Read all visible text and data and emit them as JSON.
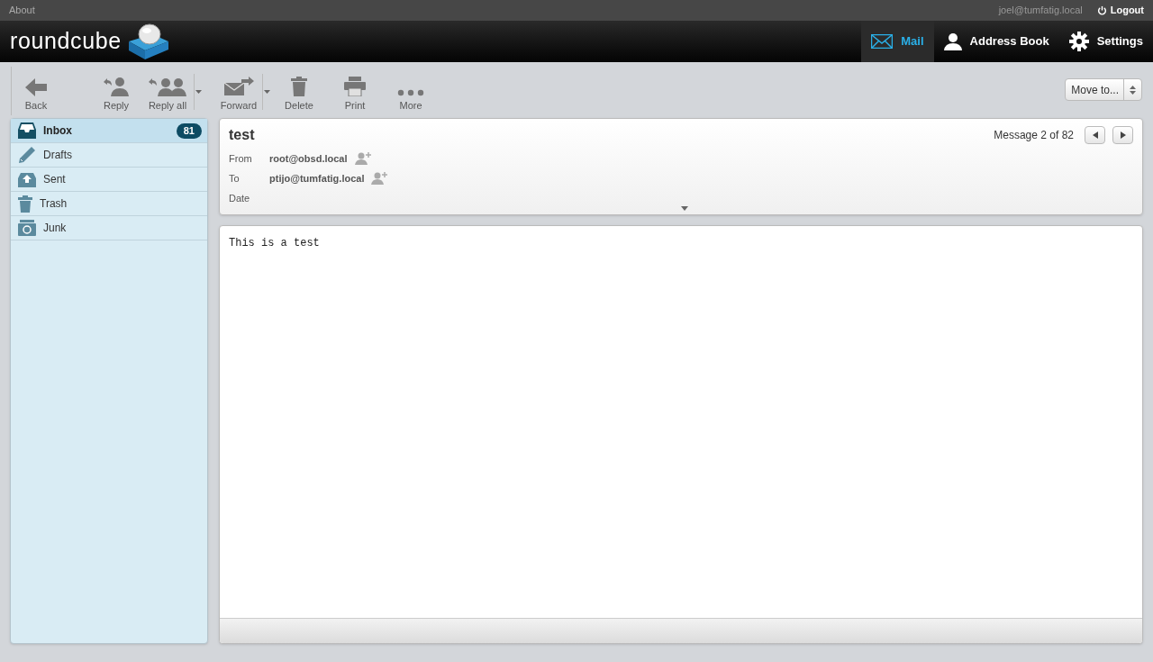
{
  "top_bar": {
    "about": "About",
    "user": "joel@tumfatig.local",
    "logout": "Logout"
  },
  "logo": "roundcube",
  "nav": [
    {
      "label": "Mail",
      "kind": "mail",
      "selected": true
    },
    {
      "label": "Address Book",
      "kind": "contacts",
      "selected": false
    },
    {
      "label": "Settings",
      "kind": "settings",
      "selected": false
    }
  ],
  "toolbar": [
    {
      "label": "Back",
      "kind": "back",
      "dropdown": false
    },
    {
      "label": "Reply",
      "kind": "reply",
      "dropdown": false
    },
    {
      "label": "Reply all",
      "kind": "replyall",
      "dropdown": true
    },
    {
      "label": "Forward",
      "kind": "forward",
      "dropdown": true
    },
    {
      "label": "Delete",
      "kind": "delete",
      "dropdown": false
    },
    {
      "label": "Print",
      "kind": "print",
      "dropdown": false
    },
    {
      "label": "More",
      "kind": "more",
      "dropdown": false
    }
  ],
  "move_to": "Move to...",
  "folders": [
    {
      "name": "Inbox",
      "kind": "inbox",
      "selected": true,
      "count": "81"
    },
    {
      "name": "Drafts",
      "kind": "drafts",
      "selected": false
    },
    {
      "name": "Sent",
      "kind": "sent",
      "selected": false
    },
    {
      "name": "Trash",
      "kind": "trash",
      "selected": false
    },
    {
      "name": "Junk",
      "kind": "junk",
      "selected": false
    }
  ],
  "message": {
    "subject": "test",
    "counter": "Message 2 of 82",
    "headers": [
      {
        "label": "From",
        "value": "root@obsd.local"
      },
      {
        "label": "To",
        "value": "ptijo@tumfatig.local"
      },
      {
        "label": "Date"
      }
    ],
    "body": "This is a test"
  }
}
